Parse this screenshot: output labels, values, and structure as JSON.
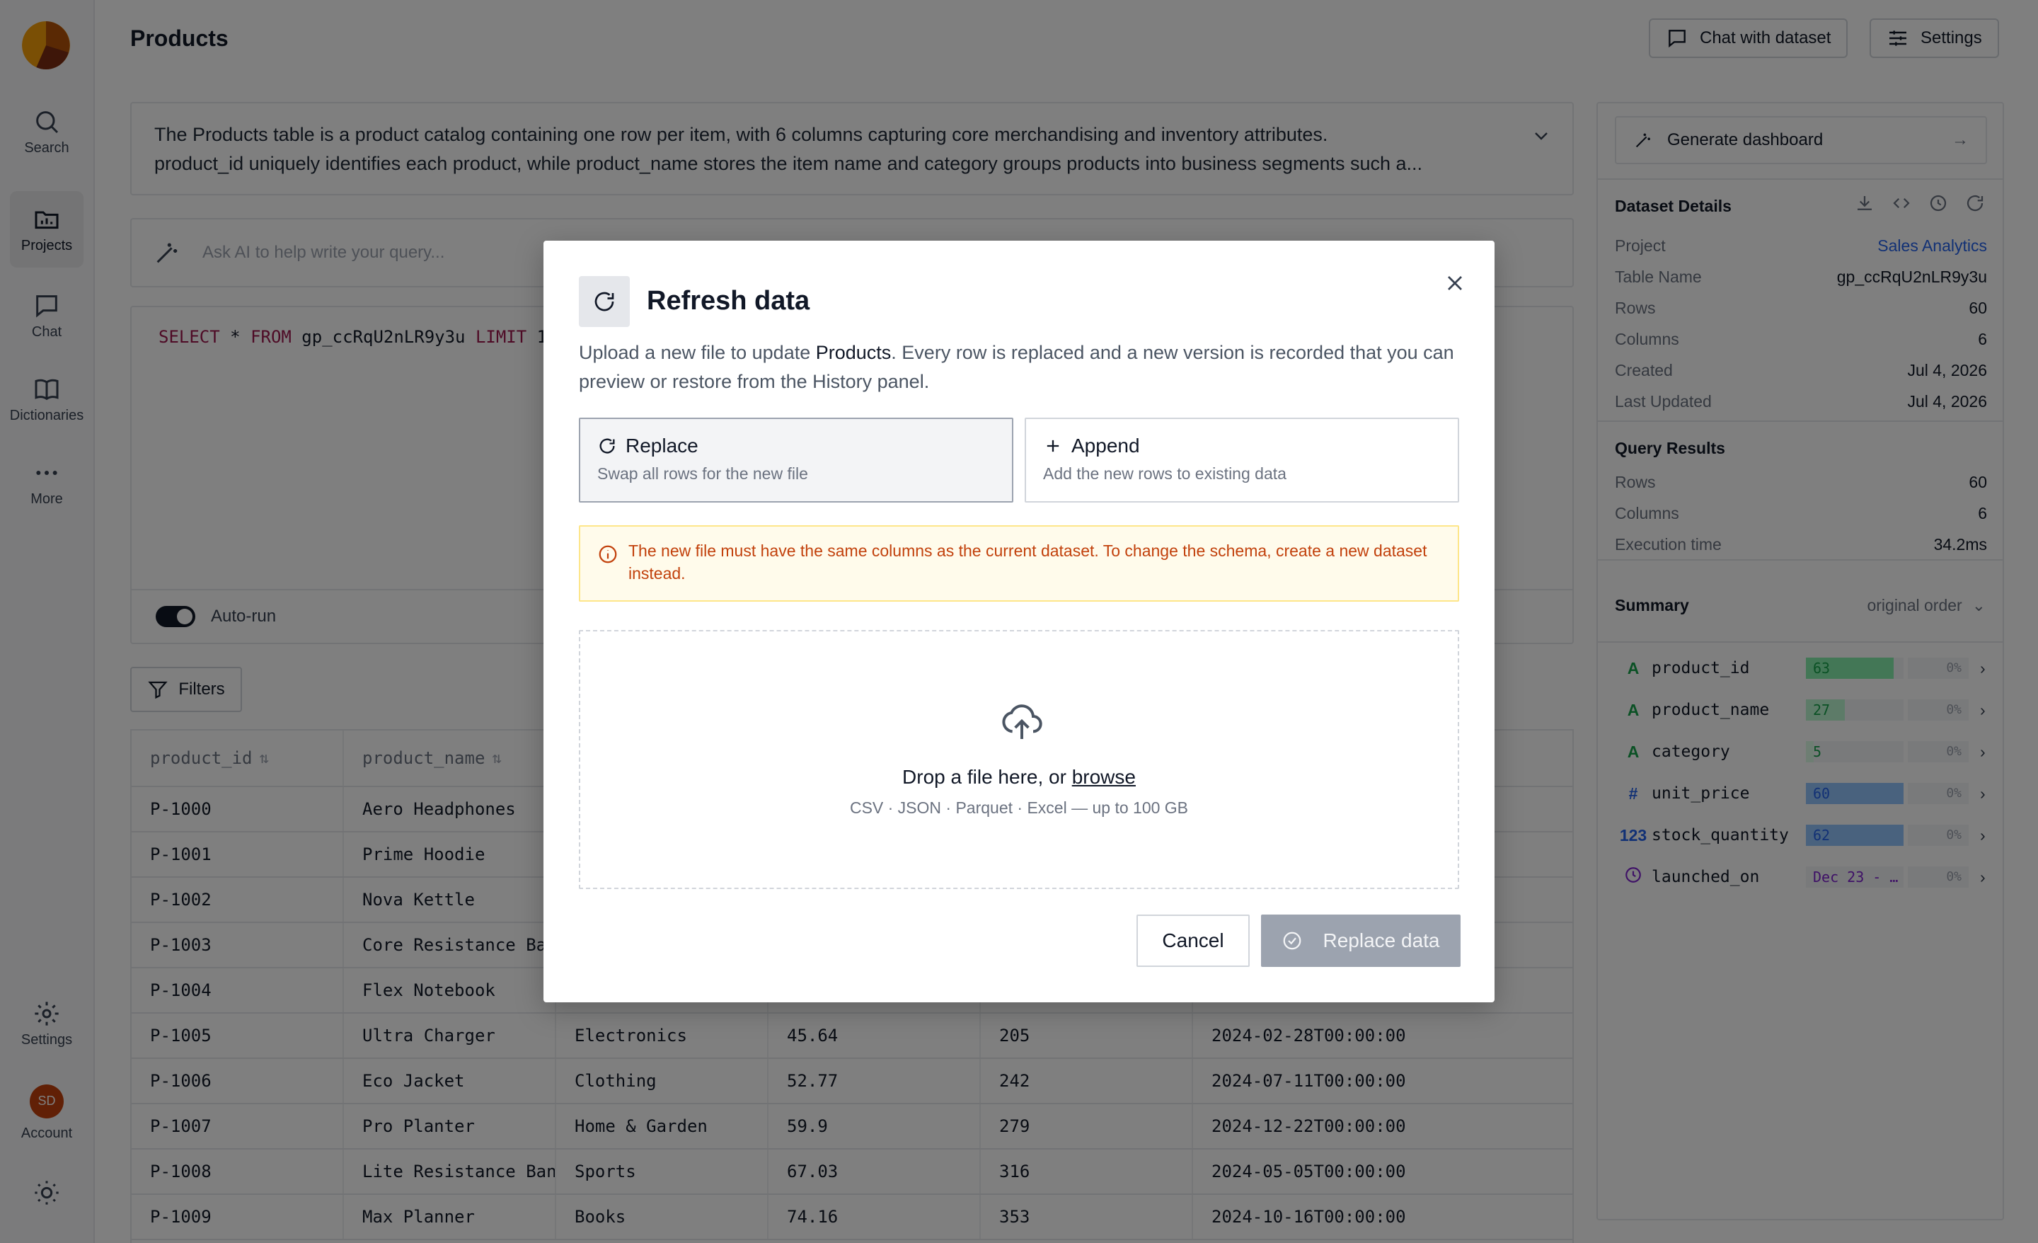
{
  "rail": {
    "items": [
      {
        "label": "Search",
        "icon": "search-icon"
      },
      {
        "label": "Projects",
        "icon": "projects-icon",
        "active": true
      },
      {
        "label": "Chat",
        "icon": "chat-icon"
      },
      {
        "label": "Dictionaries",
        "icon": "book-icon"
      },
      {
        "label": "More",
        "icon": "more-icon"
      }
    ],
    "settings_label": "Settings",
    "account_label": "Account",
    "avatar_initials": "SD"
  },
  "header": {
    "title": "Products",
    "chat_button": "Chat with dataset",
    "settings_button": "Settings"
  },
  "description": {
    "line1": "The Products table is a product catalog containing one row per item, with 6 columns capturing core merchandising and inventory attributes.",
    "line2": "product_id uniquely identifies each product, while product_name stores the item name and category groups products into business segments such a..."
  },
  "ask": {
    "placeholder": "Ask AI to help write your query..."
  },
  "editor": {
    "kw_select": "SELECT",
    "star": " * ",
    "kw_from": "FROM",
    "table": " gp_ccRqU2nLR9y3u ",
    "kw_limit": "LIMIT",
    "limit_val": " 1",
    "autorun_label": "Auto-run"
  },
  "filters_label": "Filters",
  "table": {
    "headers": [
      "product_id",
      "product_name",
      "",
      "",
      "",
      ""
    ],
    "rows": [
      [
        "P-1000",
        "Aero Headphones",
        "",
        "",
        "",
        ""
      ],
      [
        "P-1001",
        "Prime Hoodie",
        "",
        "",
        "",
        ""
      ],
      [
        "P-1002",
        "Nova Kettle",
        "",
        "",
        "",
        ""
      ],
      [
        "P-1003",
        "Core Resistance Ba",
        "",
        "",
        "",
        ""
      ],
      [
        "P-1004",
        "Flex Notebook",
        "",
        "",
        "",
        ""
      ],
      [
        "P-1005",
        "Ultra Charger",
        "Electronics",
        "45.64",
        "205",
        "2024-02-28T00:00:00."
      ],
      [
        "P-1006",
        "Eco Jacket",
        "Clothing",
        "52.77",
        "242",
        "2024-07-11T00:00:00."
      ],
      [
        "P-1007",
        "Pro Planter",
        "Home & Garden",
        "59.9",
        "279",
        "2024-12-22T00:00:00."
      ],
      [
        "P-1008",
        "Lite Resistance Ban",
        "Sports",
        "67.03",
        "316",
        "2024-05-05T00:00:00."
      ],
      [
        "P-1009",
        "Max Planner",
        "Books",
        "74.16",
        "353",
        "2024-10-16T00:00:00."
      ]
    ]
  },
  "panel": {
    "generate_label": "Generate dashboard",
    "details_title": "Dataset Details",
    "details": [
      {
        "k": "Project",
        "v": "Sales Analytics",
        "link": true
      },
      {
        "k": "Table Name",
        "v": "gp_ccRqU2nLR9y3u"
      },
      {
        "k": "Rows",
        "v": "60"
      },
      {
        "k": "Columns",
        "v": "6"
      },
      {
        "k": "Created",
        "v": "Jul 4, 2026"
      },
      {
        "k": "Last Updated",
        "v": "Jul 4, 2026"
      }
    ],
    "results_title": "Query Results",
    "results": [
      {
        "k": "Rows",
        "v": "60"
      },
      {
        "k": "Columns",
        "v": "6"
      },
      {
        "k": "Execution time",
        "v": "34.2ms"
      }
    ],
    "summary_title": "Summary",
    "summary_order": "original order",
    "summary": [
      {
        "type": "A",
        "name": "product_id",
        "count": "63",
        "pct": "0%",
        "color": "#16a34a",
        "fill": "#86efac",
        "ratio": 0.9
      },
      {
        "type": "A",
        "name": "product_name",
        "count": "27",
        "pct": "0%",
        "color": "#16a34a",
        "fill": "#bbf7d0",
        "ratio": 0.4
      },
      {
        "type": "A",
        "name": "category",
        "count": "5",
        "pct": "0%",
        "color": "#16a34a",
        "fill": "#dcfce7",
        "ratio": 0.08
      },
      {
        "type": "#",
        "name": "unit_price",
        "count": "60",
        "pct": "0%",
        "color": "#2563eb",
        "fill": "#93c5fd",
        "ratio": 1.0
      },
      {
        "type": "123",
        "name": "stock_quantity",
        "count": "62",
        "pct": "0%",
        "color": "#2563eb",
        "fill": "#93c5fd",
        "ratio": 1.0
      },
      {
        "type": "clock",
        "name": "launched_on",
        "count": "Dec 23 - …",
        "pct": "0%",
        "color": "#7e22ce",
        "fill": "transparent",
        "ratio": 0
      }
    ]
  },
  "modal": {
    "title": "Refresh data",
    "desc_pre": "Upload a new file to update ",
    "desc_bold": "Products",
    "desc_post": ". Every row is replaced and a new version is recorded that you can preview or restore from the History panel.",
    "replace_title": "Replace",
    "replace_sub": "Swap all rows for the new file",
    "append_title": "Append",
    "append_sub": "Add the new rows to existing data",
    "warning": "The new file must have the same columns as the current dataset. To change the schema, create a new dataset instead.",
    "drop_pre": "Drop a file here, or ",
    "drop_link": "browse",
    "drop_formats": "CSV · JSON · Parquet · Excel — up to 100 GB",
    "cancel_label": "Cancel",
    "confirm_label": "Replace data"
  }
}
